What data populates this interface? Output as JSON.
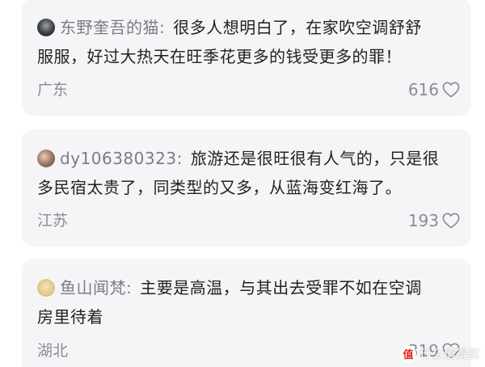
{
  "comments": [
    {
      "avatar_icon": "user-avatar-icon",
      "username": "东野奎吾的猫",
      "separator": ":",
      "content_line1": "很多人想明白了，在家吹空调舒舒",
      "line2": "服服，好过大热天在旺季花更多的钱受更多的罪！",
      "region": "广东",
      "likes": "616"
    },
    {
      "avatar_icon": "user-avatar-icon",
      "username": "dy106380323",
      "separator": ":",
      "content_line1": "旅游还是很旺很有人气的，只是很",
      "line2": "多民宿太贵了，同类型的又多，从蓝海变红海了。",
      "region": "江苏",
      "likes": "193"
    },
    {
      "avatar_icon": "user-avatar-icon",
      "username": "鱼山闻梵",
      "separator": ":",
      "content_line1": "主要是高温，与其出去受罪不如在空调",
      "line2": "房里待着",
      "region": "湖北",
      "likes": "319"
    }
  ],
  "watermark": {
    "logo_glyph": "值",
    "text": "什么值得买"
  },
  "colors": {
    "card_background": "#f5f5f7",
    "username": "#7a7d85",
    "content": "#222222",
    "meta": "#8a8d94"
  }
}
